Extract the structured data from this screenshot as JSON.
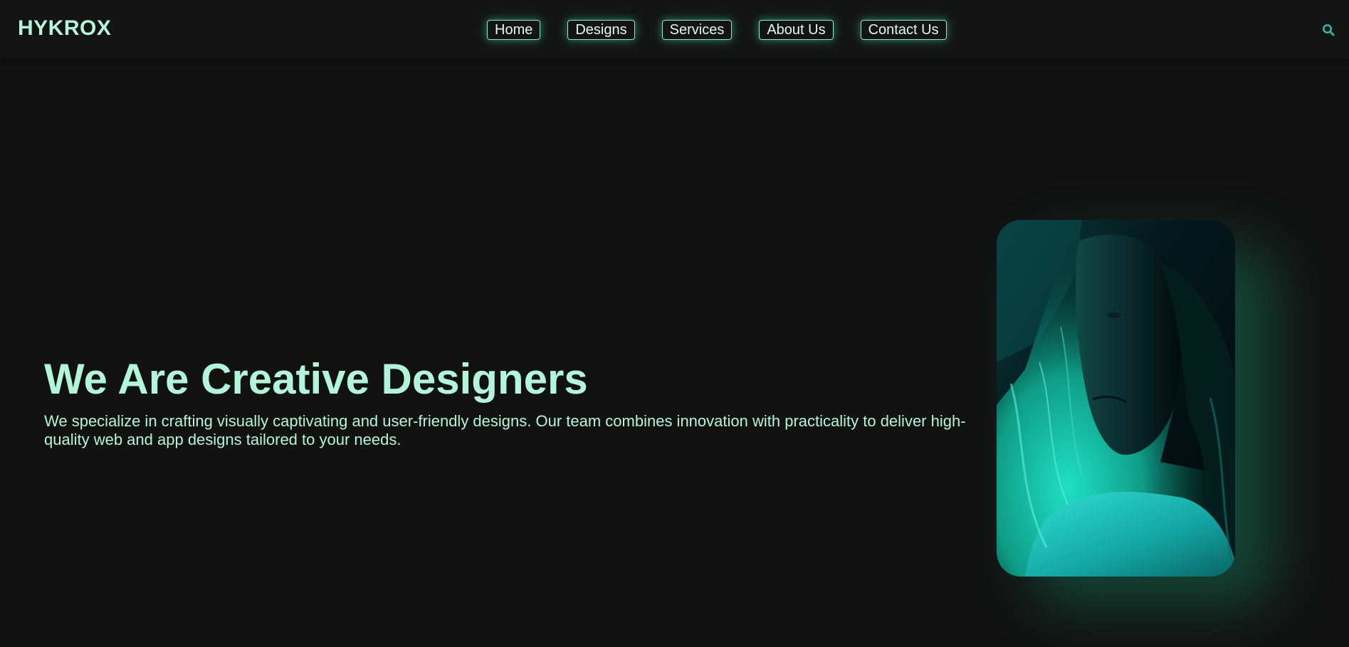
{
  "brand": {
    "logo_text": "HYKROX"
  },
  "nav": {
    "items": [
      {
        "label": "Home"
      },
      {
        "label": "Designs"
      },
      {
        "label": "Services"
      },
      {
        "label": "About Us"
      },
      {
        "label": "Contact Us"
      }
    ],
    "search_icon": "search-icon"
  },
  "hero": {
    "title": "We Are Creative Designers",
    "description": "We specialize in crafting visually captivating and user-friendly designs. Our team combines innovation with practicality to deliver high-quality web and app designs tailored to your needs.",
    "image": "portrait-photo"
  },
  "colors": {
    "background": "#121212",
    "navbar": "#141414",
    "accent": "#b3f5dc",
    "glow": "#40e6aa",
    "search_icon": "#2bb5a0"
  }
}
